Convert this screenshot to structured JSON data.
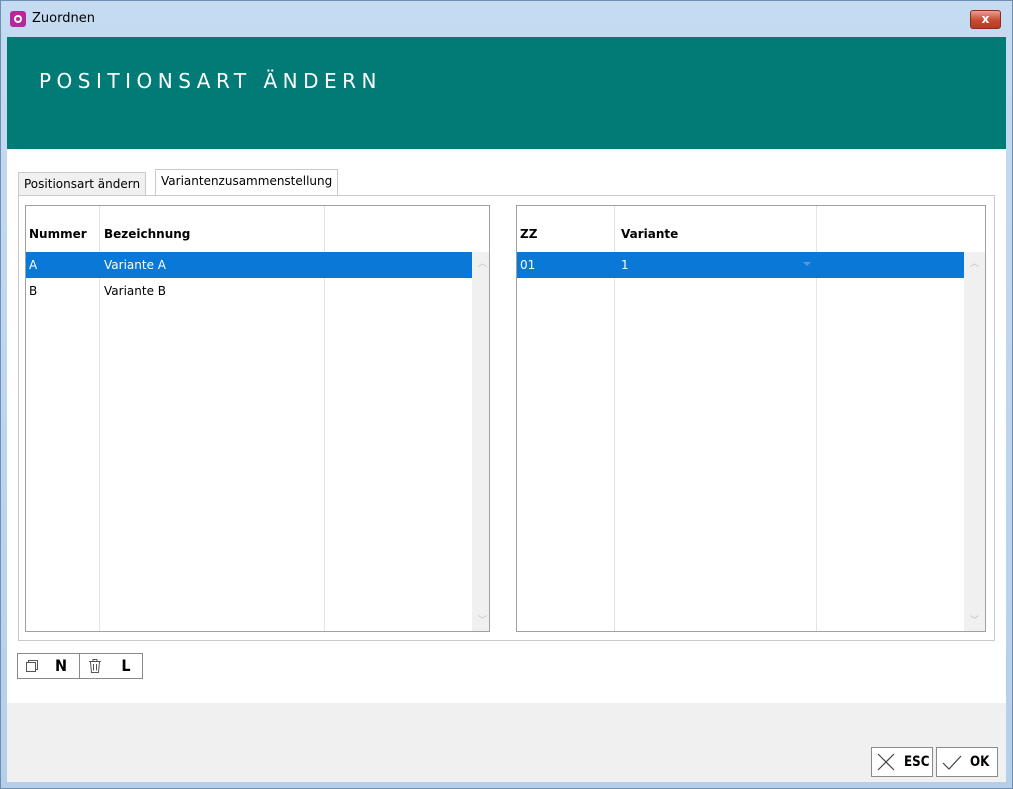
{
  "window": {
    "title": "Zuordnen",
    "close_label": "x"
  },
  "banner": {
    "title": "POSITIONSART ÄNDERN",
    "color": "#027b77"
  },
  "tabs": [
    {
      "label": "Positionsart ändern",
      "active": false
    },
    {
      "label": "Variantenzusammenstellung",
      "active": true
    }
  ],
  "left_grid": {
    "columns": [
      "Nummer",
      "Bezeichnung"
    ],
    "rows": [
      {
        "nummer": "A",
        "bezeichnung": "Variante A",
        "selected": true
      },
      {
        "nummer": "B",
        "bezeichnung": "Variante B",
        "selected": false
      }
    ]
  },
  "right_grid": {
    "columns": [
      "ZZ",
      "Variante"
    ],
    "rows": [
      {
        "zz": "01",
        "variante": "1",
        "selected": true
      }
    ]
  },
  "toolbar": {
    "new_label": "N",
    "delete_label": "L"
  },
  "footer": {
    "esc_label": "ESC",
    "ok_label": "OK"
  },
  "colors": {
    "selection": "#0a78d7",
    "banner": "#027b77"
  }
}
